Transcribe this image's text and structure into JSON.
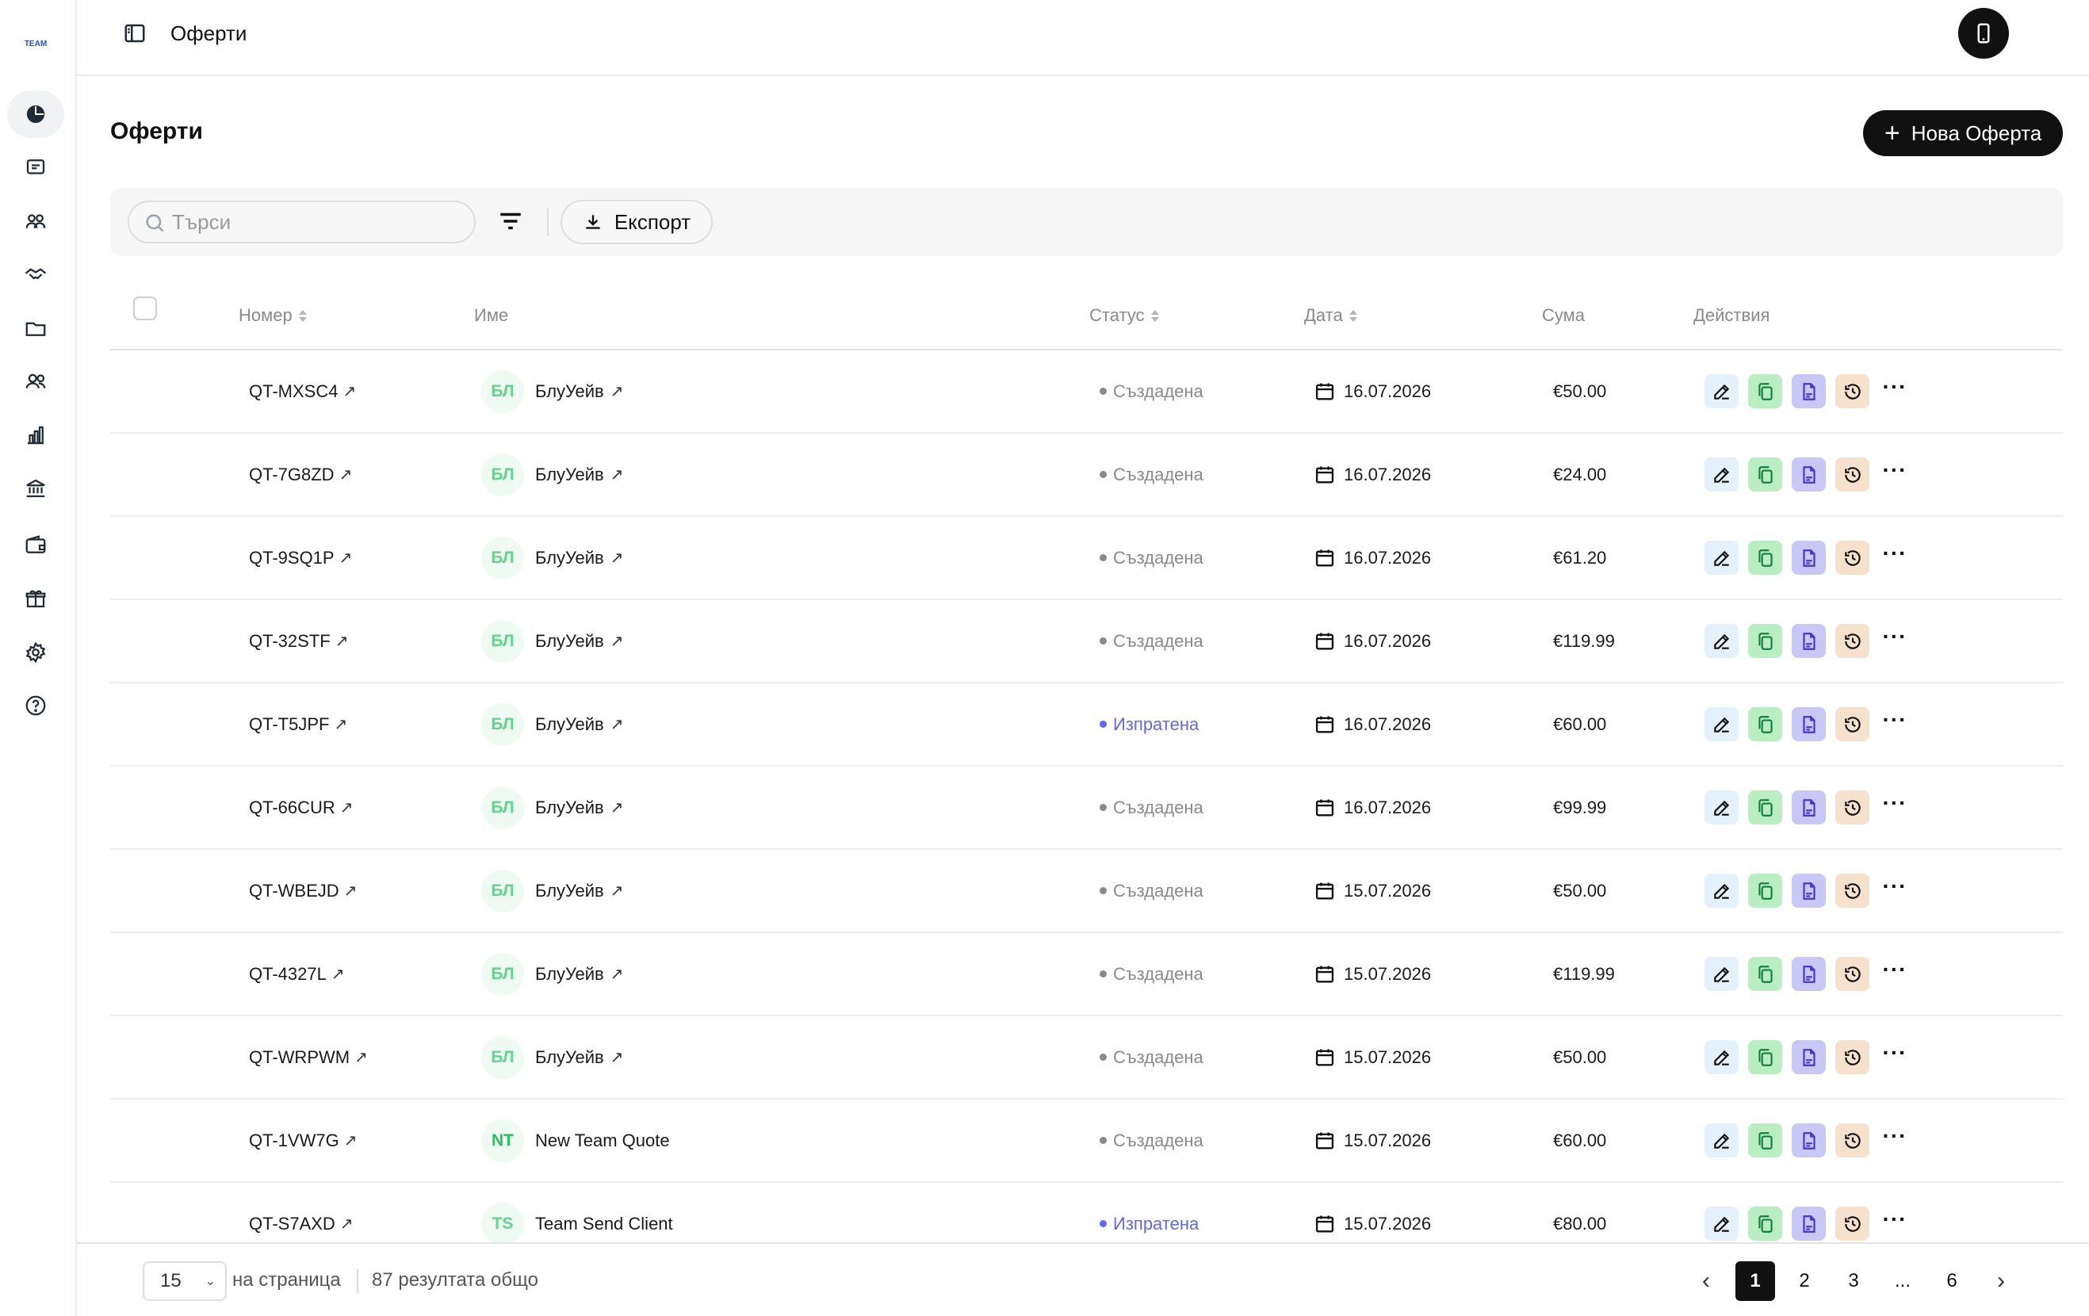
{
  "app": {
    "logo_text": "TEAM"
  },
  "header": {
    "title": "Оферти"
  },
  "page": {
    "title": "Оферти",
    "new_button": "Нова Оферта"
  },
  "toolbar": {
    "search_placeholder": "Търси",
    "export_label": "Експорт"
  },
  "sidebar": {
    "items": [
      {
        "icon": "pie-chart-icon",
        "active": true
      },
      {
        "icon": "message-icon",
        "active": false
      },
      {
        "icon": "users-group-icon",
        "active": false
      },
      {
        "icon": "handshake-icon",
        "active": false
      },
      {
        "icon": "folder-icon",
        "active": false
      },
      {
        "icon": "users-icon",
        "active": false
      },
      {
        "icon": "bar-chart-icon",
        "active": false
      },
      {
        "icon": "bank-icon",
        "active": false
      },
      {
        "icon": "wallet-icon",
        "active": false
      },
      {
        "icon": "gift-icon",
        "active": false
      },
      {
        "icon": "gear-icon",
        "active": false
      },
      {
        "icon": "help-icon",
        "active": false
      }
    ]
  },
  "table": {
    "columns": {
      "number": "Номер",
      "name": "Име",
      "status": "Статус",
      "date": "Дата",
      "sum": "Сума",
      "actions": "Действия"
    },
    "rows": [
      {
        "number": "QT-MXSC4",
        "initials": "БЛ",
        "name": "БлуУейв",
        "name_link": true,
        "status": "Създадена",
        "status_type": "created",
        "date": "16.07.2026",
        "sum": "€50.00"
      },
      {
        "number": "QT-7G8ZD",
        "initials": "БЛ",
        "name": "БлуУейв",
        "name_link": true,
        "status": "Създадена",
        "status_type": "created",
        "date": "16.07.2026",
        "sum": "€24.00"
      },
      {
        "number": "QT-9SQ1P",
        "initials": "БЛ",
        "name": "БлуУейв",
        "name_link": true,
        "status": "Създадена",
        "status_type": "created",
        "date": "16.07.2026",
        "sum": "€61.20"
      },
      {
        "number": "QT-32STF",
        "initials": "БЛ",
        "name": "БлуУейв",
        "name_link": true,
        "status": "Създадена",
        "status_type": "created",
        "date": "16.07.2026",
        "sum": "€119.99"
      },
      {
        "number": "QT-T5JPF",
        "initials": "БЛ",
        "name": "БлуУейв",
        "name_link": true,
        "status": "Изпратена",
        "status_type": "sent",
        "date": "16.07.2026",
        "sum": "€60.00"
      },
      {
        "number": "QT-66CUR",
        "initials": "БЛ",
        "name": "БлуУейв",
        "name_link": true,
        "status": "Създадена",
        "status_type": "created",
        "date": "16.07.2026",
        "sum": "€99.99"
      },
      {
        "number": "QT-WBEJD",
        "initials": "БЛ",
        "name": "БлуУейв",
        "name_link": true,
        "status": "Създадена",
        "status_type": "created",
        "date": "15.07.2026",
        "sum": "€50.00"
      },
      {
        "number": "QT-4327L",
        "initials": "БЛ",
        "name": "БлуУейв",
        "name_link": true,
        "status": "Създадена",
        "status_type": "created",
        "date": "15.07.2026",
        "sum": "€119.99"
      },
      {
        "number": "QT-WRPWM",
        "initials": "БЛ",
        "name": "БлуУейв",
        "name_link": true,
        "status": "Създадена",
        "status_type": "created",
        "date": "15.07.2026",
        "sum": "€50.00"
      },
      {
        "number": "QT-1VW7G",
        "initials": "NT",
        "name": "New Team Quote",
        "name_link": false,
        "status": "Създадена",
        "status_type": "created",
        "date": "15.07.2026",
        "sum": "€60.00"
      },
      {
        "number": "QT-S7AXD",
        "initials": "TS",
        "name": "Team Send Client",
        "name_link": false,
        "status": "Изпратена",
        "status_type": "sent",
        "date": "15.07.2026",
        "sum": "€80.00"
      }
    ]
  },
  "colors": {
    "status_created": "#8a8a8a",
    "status_sent": "#6366f1",
    "avatar_bg": "#effbf2",
    "avatar_text": "#5fd68a",
    "avatar_text_nt": "#22c55e"
  },
  "pagination": {
    "per_page": "15",
    "per_page_label": "на страница",
    "total": "87 резултата общо",
    "pages": [
      "1",
      "2",
      "3",
      "...",
      "6"
    ],
    "current": "1"
  }
}
